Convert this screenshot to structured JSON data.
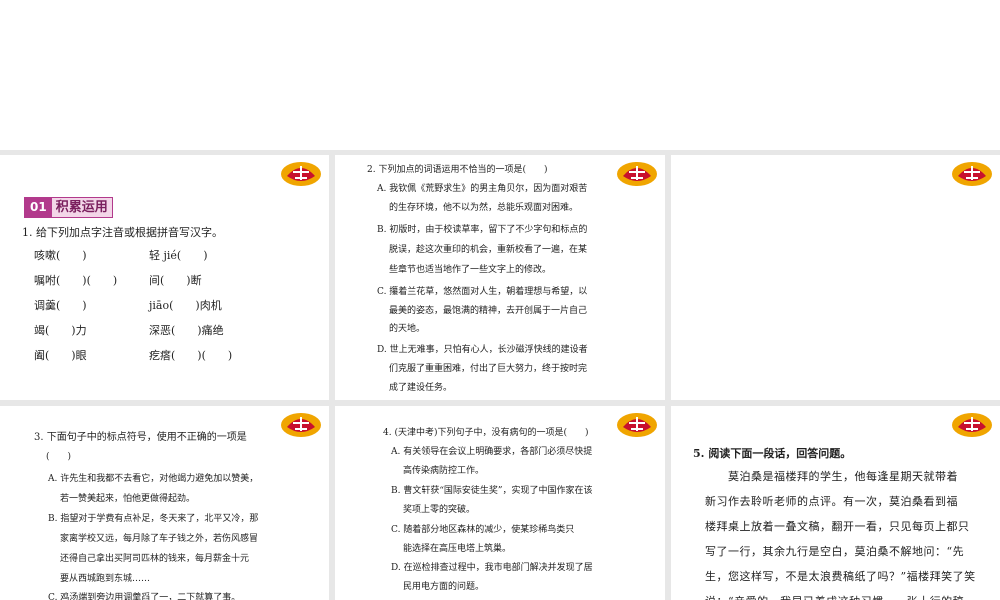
{
  "section": {
    "number": "01",
    "title": "积累运用"
  },
  "q1": {
    "title": "1. 给下列加点字注音或根据拼音写汉字。",
    "rows": [
      [
        "咳嗽(　　)",
        "轻 jié(　　)"
      ],
      [
        "嘱咐(　　)(　　)",
        "间(　　)断"
      ],
      [
        "调羹(　　)",
        "jiāo(　　)肉机"
      ],
      [
        "竭(　　)力",
        "深恶(　　)痛绝"
      ],
      [
        "阖(　　)眼",
        "疙瘩(　　)(　　)"
      ]
    ]
  },
  "q2": {
    "title": "2. 下列加点的词语运用不恰当的一项是(　　)",
    "lines": [
      "A. 我钦佩《荒野求生》的男主角贝尔，因为面对艰苦",
      "的生存环境，他不以为然，总能乐观面对困难。",
      "B. 初版时，由于校读草率，留下了不少字句和标点的",
      "脱误，趁这次重印的机会，重新校看了一遍，在某",
      "些章节也适当地作了一些文字上的修改。",
      "C. 攥着兰花草，悠然面对人生，朝着理想与希望，以",
      "最美的姿态，最饱满的精神，去开创属于一片自己",
      "的天地。",
      "D. 世上无难事，只怕有心人，长沙磁浮快线的建设者",
      "们克服了重重困难，付出了巨大努力，终于按时完",
      "成了建设任务。"
    ]
  },
  "q3": {
    "title1": "3. 下面句子中的标点符号，使用不正确的一项是",
    "title2": "(　　)",
    "lines": [
      "A. 许先生和我都不去看它，对他竭力避免加以赞美，",
      "若一赞美起来，怕他更做得起劲。",
      "B. 指望对于学费有点补足，冬天来了，北平又冷，那",
      "家离学校又远，每月除了车子钱之外，若伤风感冒",
      "还得自己拿出买阿司匹林的钱来，每月薪金十元",
      "要从西城跑到东城……",
      "C. 鸡汤端到旁边用调羹舀了一，二下就算了事。"
    ]
  },
  "q4": {
    "title": "4. (天津中考)下列句子中，没有病句的一项是(　　)",
    "lines": [
      "A. 有关领导在会议上明确要求，各部门必须尽快提",
      "高传染病防控工作。",
      "B. 曹文轩获“国际安徒生奖”，实现了中国作家在该",
      "奖项上零的突破。",
      "C. 随着部分地区森林的减少，使某珍稀鸟类只",
      "能选择在高压电塔上筑巢。",
      "D. 在巡检排查过程中，我市电部门解决并发现了居",
      "民用电方面的问题。"
    ]
  },
  "q5": {
    "title": "5. 阅读下面一段话，回答问题。",
    "lines": [
      "　　莫泊桑是福楼拜的学生，他每逢星期天就带着",
      "新习作去聆听老师的点评。有一次，莫泊桑看到福",
      "楼拜桌上放着一叠文稿，翻开一看，只见每页上都只",
      "写了一行，其余九行是空白，莫泊桑不解地问：“先",
      "生，您这样写，不是太浪费稿纸了吗？”福楼拜笑了笑",
      "说：“亲爱的，我早已养成这种习惯，一张十行的稿"
    ]
  },
  "colors": {
    "accent": "#b23a8c",
    "accent_light": "#f3d6e8",
    "logo_red": "#c8102e",
    "logo_gold": "#f0a500"
  }
}
